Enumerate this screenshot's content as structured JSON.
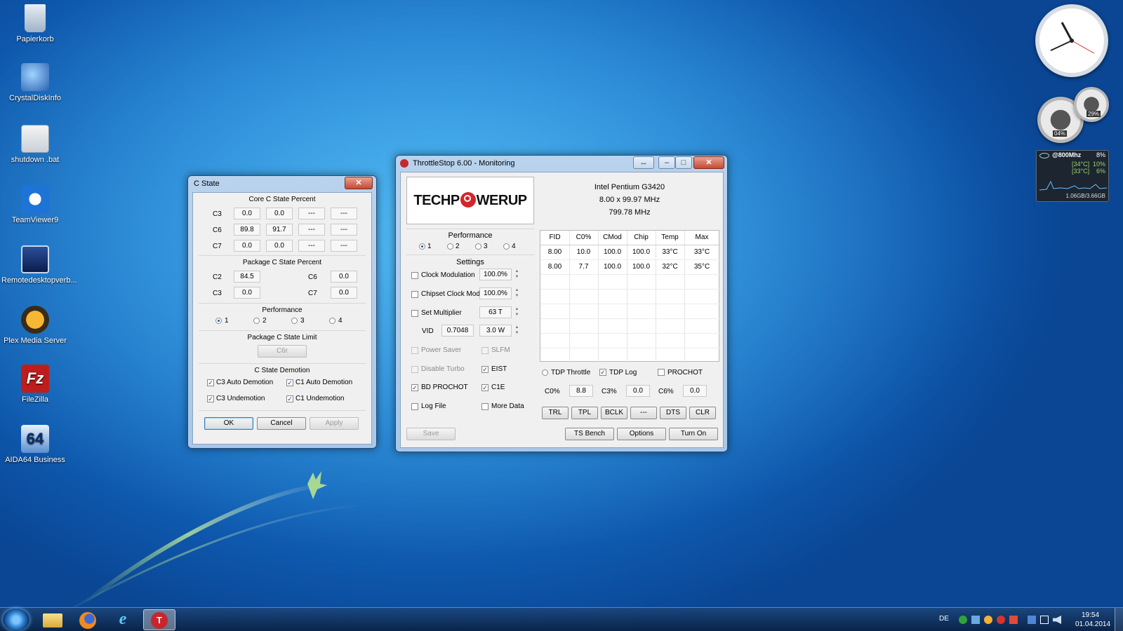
{
  "desktop": {
    "icons": [
      {
        "label": "Papierkorb"
      },
      {
        "label": "CrystalDiskInfo"
      },
      {
        "label": "shutdown .bat"
      },
      {
        "label": "TeamViewer9"
      },
      {
        "label": "Remotedesktopverb..."
      },
      {
        "label": "Plex Media Server"
      },
      {
        "label": "FileZilla"
      },
      {
        "label": "AIDA64 Business"
      }
    ]
  },
  "cstate": {
    "title": "C State",
    "core_title": "Core C State Percent",
    "core_rows": [
      {
        "label": "C3",
        "v": [
          "0.0",
          "0.0",
          "---",
          "---"
        ]
      },
      {
        "label": "C6",
        "v": [
          "89.8",
          "91.7",
          "---",
          "---"
        ]
      },
      {
        "label": "C7",
        "v": [
          "0.0",
          "0.0",
          "---",
          "---"
        ]
      }
    ],
    "pkg_title": "Package C State Percent",
    "pkg": {
      "c2_label": "C2",
      "c2": "84.5",
      "c6_label": "C6",
      "c6": "0.0",
      "c3_label": "C3",
      "c3": "0.0",
      "c7_label": "C7",
      "c7": "0.0"
    },
    "perf_title": "Performance",
    "perf_options": [
      "1",
      "2",
      "3",
      "4"
    ],
    "limit_title": "Package C State Limit",
    "limit_value": "C6r",
    "demotion_title": "C State Demotion",
    "demotion": [
      "C3 Auto Demotion",
      "C1 Auto Demotion",
      "C3 Undemotion",
      "C1 Undemotion"
    ],
    "ok": "OK",
    "cancel": "Cancel",
    "apply": "Apply"
  },
  "throttlestop": {
    "title": "ThrottleStop 6.00 - Monitoring",
    "logo_text_left": "TECHP",
    "logo_text_right": "WERUP",
    "cpu_name": "Intel Pentium G3420",
    "multiplier": "8.00 x 99.97 MHz",
    "freq": "799.78 MHz",
    "perf_title": "Performance",
    "perf_options": [
      "1",
      "2",
      "3",
      "4"
    ],
    "settings_title": "Settings",
    "clock_mod_label": "Clock Modulation",
    "clock_mod_value": "100.0%",
    "chipset_label": "Chipset Clock Mod",
    "chipset_value": "100.0%",
    "set_mult_label": "Set Multiplier",
    "set_mult_value": "63 T",
    "vid_label": "VID",
    "vid_value": "0.7048",
    "power_value": "3.0 W",
    "power_saver": "Power Saver",
    "slfm": "SLFM",
    "disable_turbo": "Disable Turbo",
    "eist": "EIST",
    "bd_prochot": "BD PROCHOT",
    "c1e": "C1E",
    "log_file": "Log File",
    "more_data": "More Data",
    "save": "Save",
    "table_headers": [
      "FID",
      "C0%",
      "CMod",
      "Chip",
      "Temp",
      "Max"
    ],
    "table_rows": [
      [
        "8.00",
        "10.0",
        "100.0",
        "100.0",
        "33°C",
        "33°C"
      ],
      [
        "8.00",
        "7.7",
        "100.0",
        "100.0",
        "32°C",
        "35°C"
      ]
    ],
    "tdp_throttle": "TDP Throttle",
    "tdp_log": "TDP Log",
    "prochot": "PROCHOT",
    "c0_label": "C0%",
    "c0_value": "8.8",
    "c3_label": "C3%",
    "c3_value": "0.0",
    "c6_label": "C6%",
    "c6_value": "0.0",
    "buttons": [
      "TRL",
      "TPL",
      "BCLK",
      "---",
      "DTS",
      "CLR"
    ],
    "ts_bench": "TS Bench",
    "options": "Options",
    "turn_on": "Turn On"
  },
  "gadget": {
    "cpu_label": "@800Mhz",
    "cpu_pct": "8%",
    "core1_temp": "[34°C]",
    "core1_pct": "10%",
    "core2_temp": "[33°C]",
    "core2_pct": "6%",
    "mem": "1.06GB/3.66GB",
    "meter_cpu": "04%",
    "meter_mem": "29%"
  },
  "taskbar": {
    "lang": "DE",
    "time": "19:54",
    "date": "01.04.2014"
  },
  "colors": {
    "accent": "#1b58a8",
    "logo_red": "#d3262c"
  }
}
